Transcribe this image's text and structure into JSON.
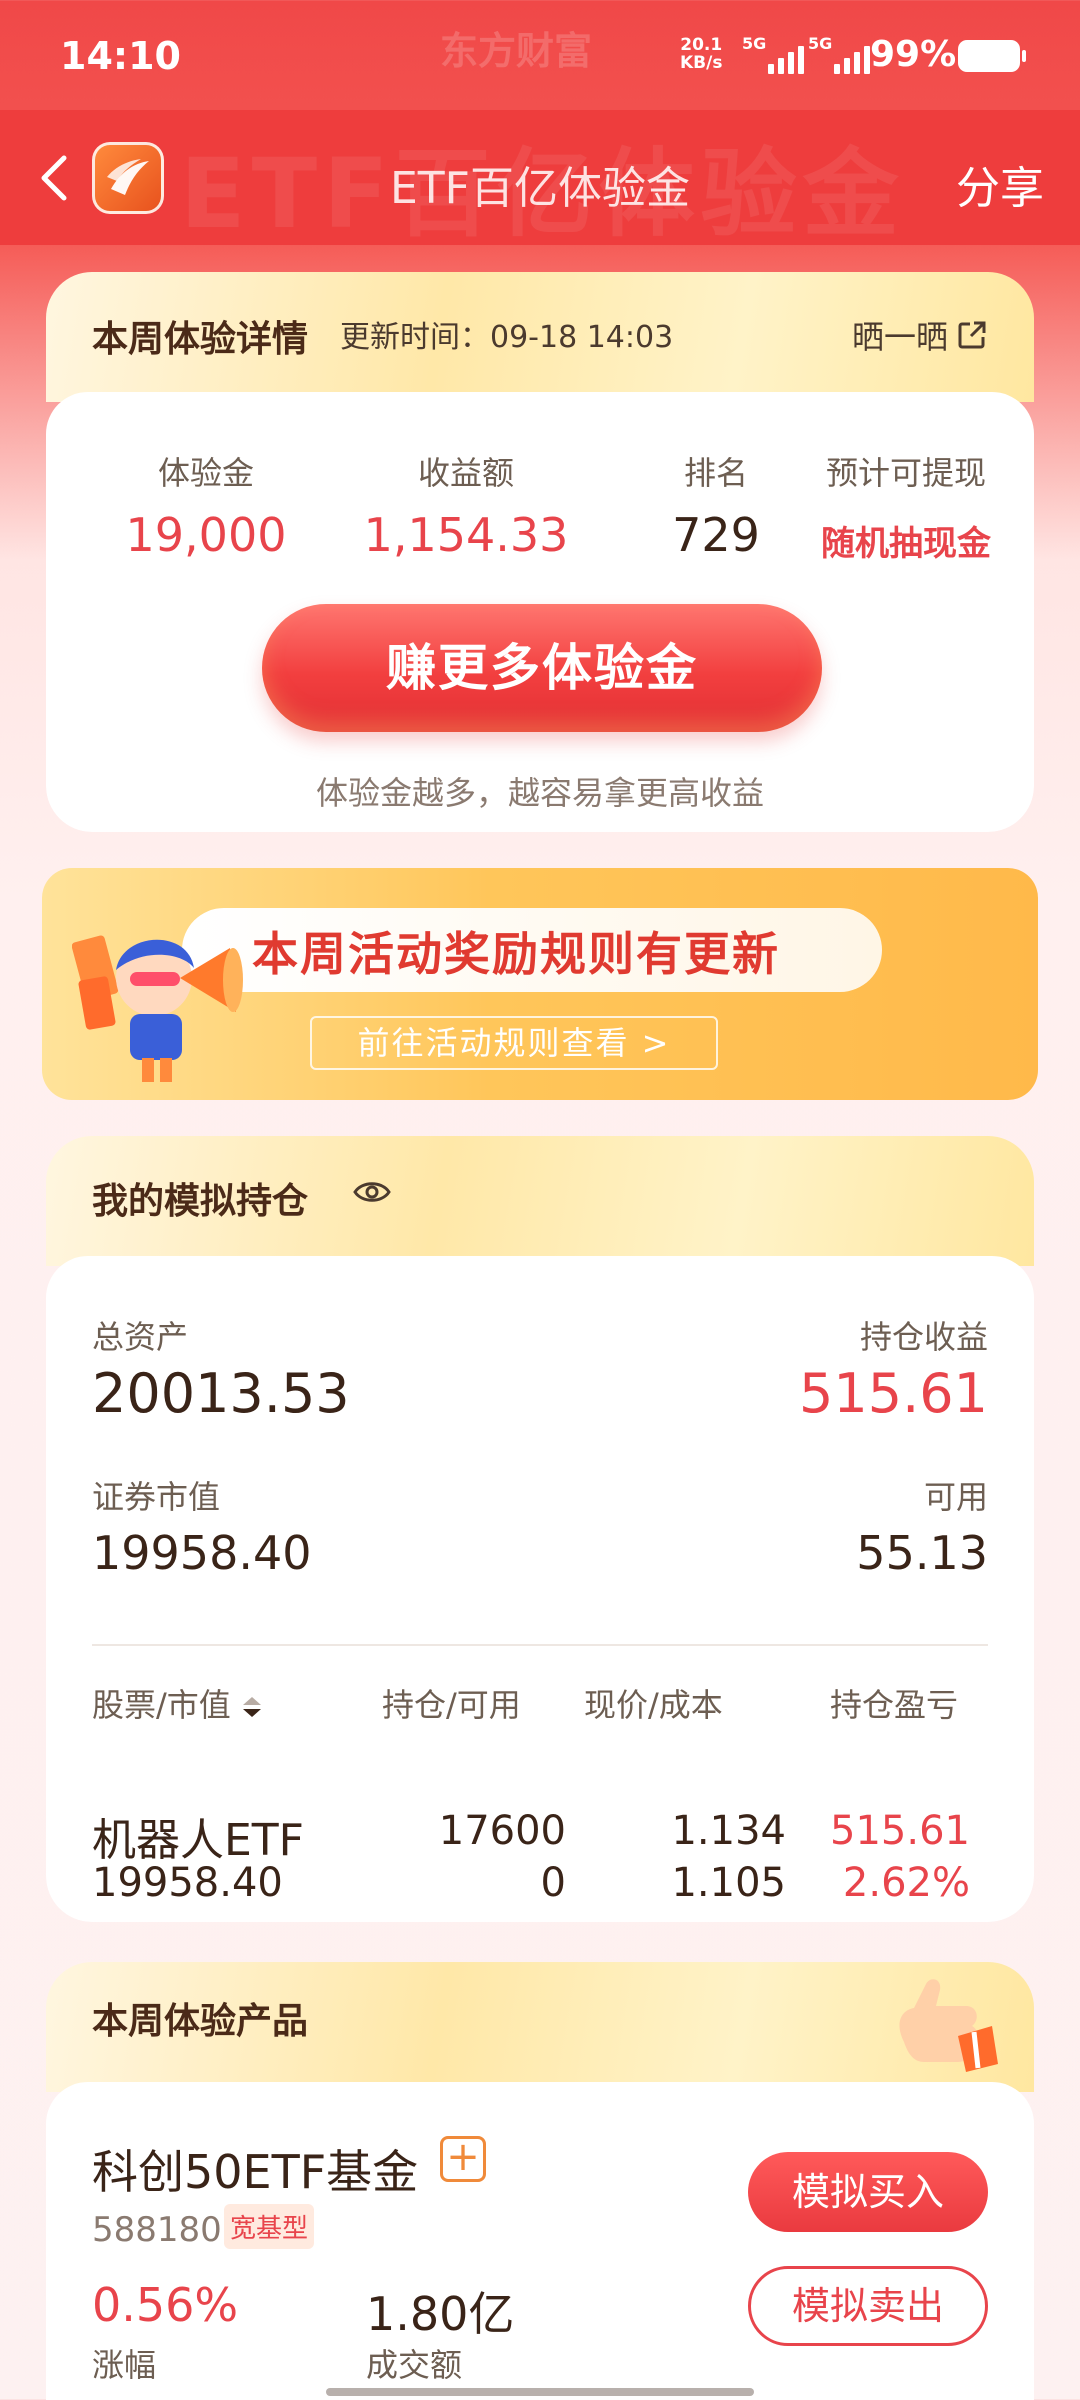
{
  "status_bar": {
    "time": "14:10",
    "ghost_brand": "东方财富",
    "net_speed_value": "20.1",
    "net_speed_unit": "KB/s",
    "sim1_label": "5G",
    "sim2_label": "5G",
    "battery": "99%"
  },
  "header": {
    "title": "ETF百亿体验金",
    "share_label": "分享",
    "ghost_text": "ETF百亿体验金"
  },
  "weekly_detail": {
    "title": "本周体验详情",
    "update_time": "更新时间：09-18 14:03",
    "share_label": "晒一晒",
    "stats": [
      {
        "label": "体验金",
        "value": "19,000"
      },
      {
        "label": "收益额",
        "value": "1,154.33"
      },
      {
        "label": "排名",
        "value": "729"
      },
      {
        "label": "预计可提现",
        "value": "随机抽现金"
      }
    ],
    "cta_label": "赚更多体验金",
    "hint": "体验金越多，越容易拿更高收益"
  },
  "banner": {
    "title": "本周活动奖励规则有更新",
    "link_label": "前往活动规则查看 >"
  },
  "positions": {
    "title": "我的模拟持仓",
    "total_assets_label": "总资产",
    "total_assets": "20013.53",
    "holding_profit_label": "持仓收益",
    "holding_profit": "515.61",
    "market_value_label": "证券市值",
    "market_value": "19958.40",
    "available_label": "可用",
    "available": "55.13",
    "columns": [
      "股票/市值",
      "持仓/可用",
      "现价/成本",
      "持仓盈亏"
    ],
    "rows": [
      {
        "name": "机器人ETF",
        "market_value": "19958.40",
        "holding": "17600",
        "available": "0",
        "price": "1.134",
        "cost": "1.105",
        "profit": "515.61",
        "profit_pct": "2.62%"
      }
    ]
  },
  "products": {
    "title": "本周体验产品",
    "fund_name": "科创50ETF基金",
    "plus": "+",
    "code": "588180",
    "tag": "宽基型",
    "change": "0.56%",
    "change_label": "涨幅",
    "volume": "1.80亿",
    "volume_label": "成交额",
    "buy_label": "模拟买入",
    "sell_label": "模拟卖出"
  },
  "colors": {
    "brand_red": "#ee3d3d",
    "profit_red": "#e8444b",
    "accent_orange": "#f08a3a"
  }
}
